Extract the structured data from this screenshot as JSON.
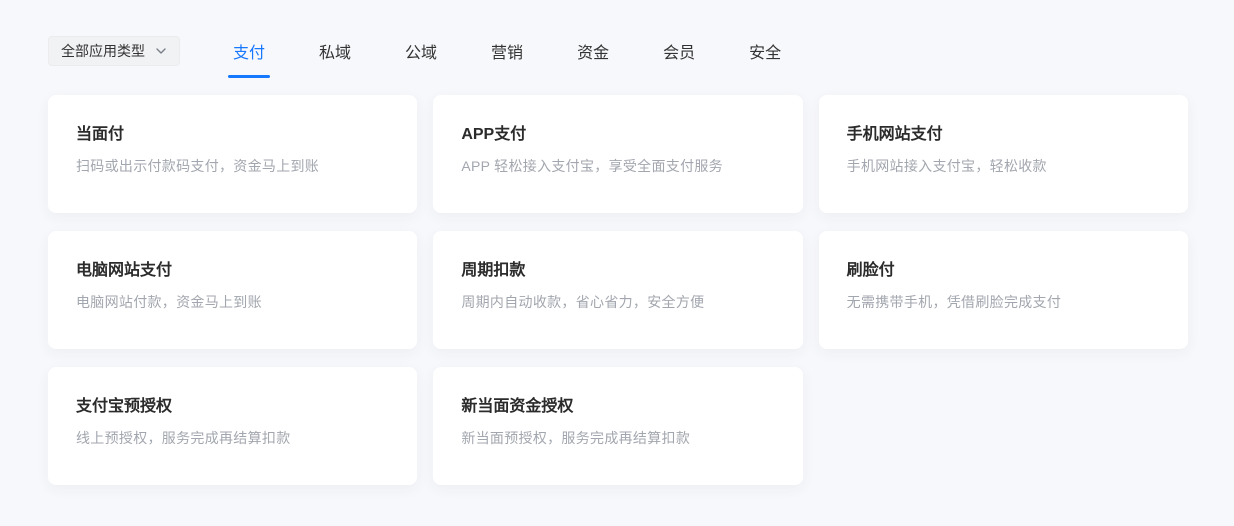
{
  "colors": {
    "accent": "#1677ff",
    "page_bg": "#f7f8fb",
    "card_bg": "#ffffff",
    "title_text": "#2b2b2b",
    "desc_text": "#a2a6ae",
    "filter_bg": "#f1f2f4"
  },
  "filter": {
    "label": "全部应用类型",
    "icon": "chevron-down-icon"
  },
  "tabs": [
    {
      "name": "payment",
      "label": "支付",
      "active": true
    },
    {
      "name": "private-domain",
      "label": "私域",
      "active": false
    },
    {
      "name": "public-domain",
      "label": "公域",
      "active": false
    },
    {
      "name": "marketing",
      "label": "营销",
      "active": false
    },
    {
      "name": "funds",
      "label": "资金",
      "active": false
    },
    {
      "name": "membership",
      "label": "会员",
      "active": false
    },
    {
      "name": "security",
      "label": "安全",
      "active": false
    }
  ],
  "cards": [
    {
      "name": "face-to-face-pay",
      "title": "当面付",
      "desc": "扫码或出示付款码支付，资金马上到账"
    },
    {
      "name": "app-pay",
      "title": "APP支付",
      "desc": "APP 轻松接入支付宝，享受全面支付服务"
    },
    {
      "name": "wap-pay",
      "title": "手机网站支付",
      "desc": "手机网站接入支付宝，轻松收款"
    },
    {
      "name": "pc-web-pay",
      "title": "电脑网站支付",
      "desc": "电脑网站付款，资金马上到账"
    },
    {
      "name": "periodic-deduction",
      "title": "周期扣款",
      "desc": "周期内自动收款，省心省力，安全方便"
    },
    {
      "name": "face-scan-pay",
      "title": "刷脸付",
      "desc": "无需携带手机，凭借刷脸完成支付"
    },
    {
      "name": "alipay-pre-auth",
      "title": "支付宝预授权",
      "desc": "线上预授权，服务完成再结算扣款"
    },
    {
      "name": "new-f2f-fund-auth",
      "title": "新当面资金授权",
      "desc": "新当面预授权，服务完成再结算扣款"
    }
  ]
}
